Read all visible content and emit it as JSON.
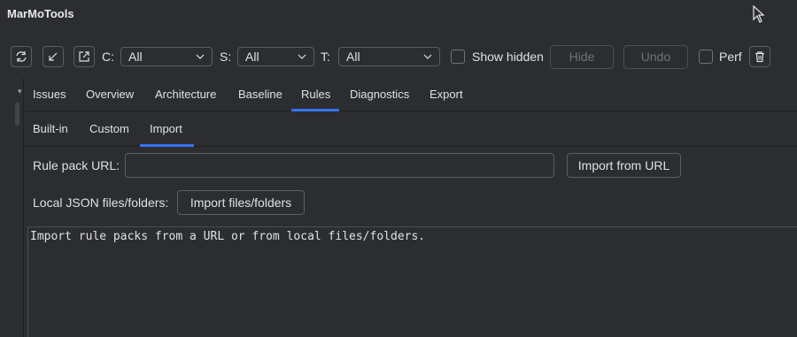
{
  "app": {
    "title": "MarMoTools"
  },
  "toolbar": {
    "c_label": "C:",
    "c_value": "All",
    "s_label": "S:",
    "s_value": "All",
    "t_label": "T:",
    "t_value": "All",
    "show_hidden_label": "Show hidden",
    "hide_label": "Hide",
    "undo_label": "Undo",
    "perf_label": "Perf",
    "icons": [
      "refresh-icon",
      "collapse-icon",
      "expand-icon",
      "trash-icon"
    ]
  },
  "tabs": {
    "items": [
      "Issues",
      "Overview",
      "Architecture",
      "Baseline",
      "Rules",
      "Diagnostics",
      "Export"
    ],
    "active": "Rules"
  },
  "subtabs": {
    "items": [
      "Built-in",
      "Custom",
      "Import"
    ],
    "active": "Import"
  },
  "import": {
    "rule_pack_url_label": "Rule pack URL:",
    "rule_pack_url_value": "",
    "import_from_url_label": "Import from URL",
    "local_label": "Local JSON files/folders:",
    "import_files_label": "Import files/folders",
    "output_text": "Import rule packs from a URL or from local files/folders."
  },
  "colors": {
    "background": "#2b2d30",
    "accent": "#3574f0",
    "border": "#5a5d63",
    "text": "#dfe1e5"
  }
}
